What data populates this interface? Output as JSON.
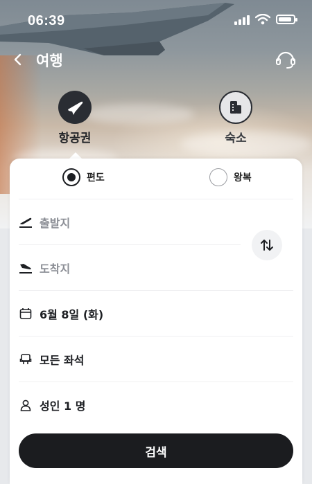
{
  "status_bar": {
    "time": "06:39"
  },
  "header": {
    "title": "여행"
  },
  "categories": [
    {
      "label": "항공권",
      "icon": "airplane-icon",
      "selected": true
    },
    {
      "label": "숙소",
      "icon": "building-icon",
      "selected": false
    }
  ],
  "trip_type": {
    "options": [
      {
        "label": "편도",
        "selected": true
      },
      {
        "label": "왕복",
        "selected": false
      }
    ]
  },
  "fields": {
    "departure_placeholder": "출발지",
    "arrival_placeholder": "도착지",
    "date": "6월 8일 (화)",
    "seat_class": "모든 좌석",
    "passengers": "성인 1 명"
  },
  "search": {
    "label": "검색"
  },
  "colors": {
    "dark": "#1b1c1f",
    "placeholder": "#8a8d94",
    "card": "#ffffff"
  }
}
